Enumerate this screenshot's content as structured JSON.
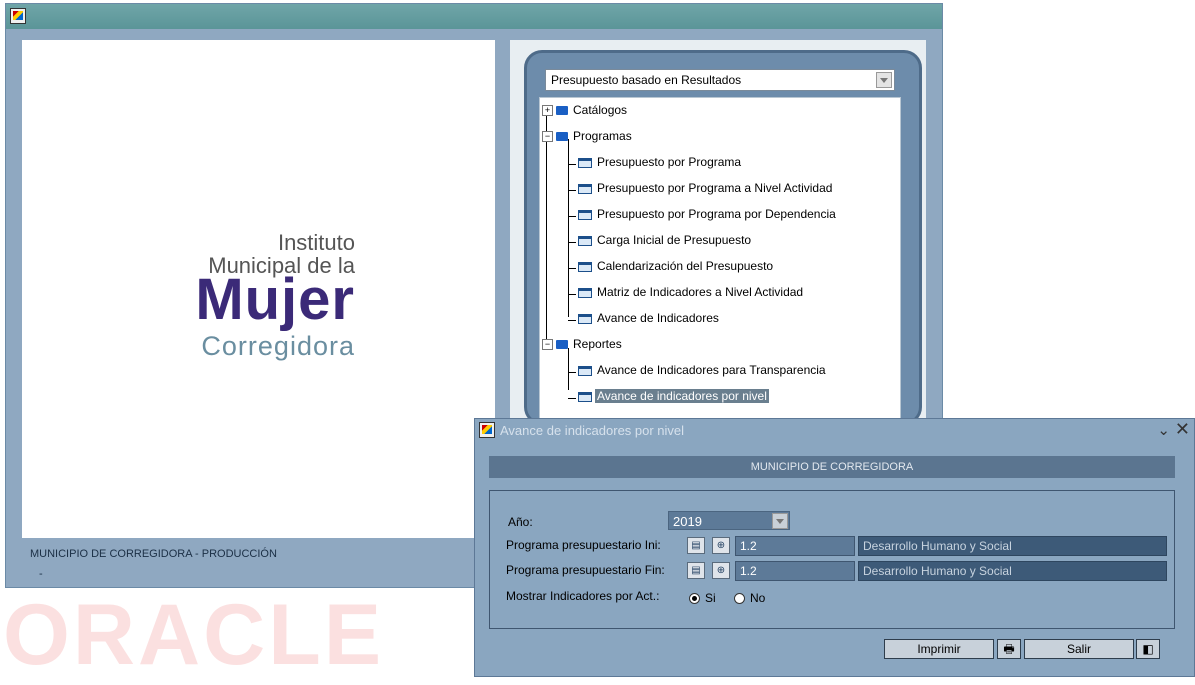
{
  "main_window": {
    "status_text": "MUNICIPIO DE CORREGIDORA - PRODUCCIÓN",
    "status_subtext": "-"
  },
  "logo": {
    "line1": "Instituto",
    "line2": "Municipal de la",
    "line3": "Mujer",
    "line4": "Corregidora"
  },
  "tree": {
    "selector_value": "Presupuesto basado en Resultados",
    "nodes": [
      {
        "label": "Catálogos",
        "icon": "folder-icon",
        "expander": "+"
      },
      {
        "label": "Programas",
        "icon": "open-folder-icon",
        "expander": "−"
      },
      {
        "label": "Presupuesto por Programa",
        "icon": "form-icon"
      },
      {
        "label": "Presupuesto por Programa a Nivel Actividad",
        "icon": "form-icon"
      },
      {
        "label": "Presupuesto por Programa por Dependencia",
        "icon": "form-icon"
      },
      {
        "label": "Carga Inicial de Presupuesto",
        "icon": "form-icon"
      },
      {
        "label": "Calendarización del Presupuesto",
        "icon": "form-icon"
      },
      {
        "label": "Matriz de Indicadores a Nivel Actividad",
        "icon": "form-icon"
      },
      {
        "label": "Avance de Indicadores",
        "icon": "form-icon"
      },
      {
        "label": "Reportes",
        "icon": "open-folder-icon",
        "expander": "−"
      },
      {
        "label": "Avance de Indicadores para Transparencia",
        "icon": "form-icon"
      },
      {
        "label": "Avance de indicadores por nivel",
        "icon": "form-icon",
        "selected": true
      }
    ]
  },
  "watermark": "ORACLE",
  "dialog": {
    "title": "Avance de indicadores por nivel",
    "minimize_glyph": "⌄",
    "close_glyph": "✕",
    "header": "MUNICIPIO DE CORREGIDORA",
    "anio_label": "Año:",
    "anio_value": "2019",
    "prog_ini_label": "Programa presupuestario Ini:",
    "prog_ini_code": "1.2",
    "prog_ini_desc": "Desarrollo Humano y Social",
    "prog_fin_label": "Programa presupuestario Fin:",
    "prog_fin_code": "1.2",
    "prog_fin_desc": "Desarrollo Humano y Social",
    "mostrar_label": "Mostrar Indicadores por Act.:",
    "radio_si": "Si",
    "radio_no": "No",
    "print_button": "Imprimir",
    "exit_button": "Salir"
  }
}
